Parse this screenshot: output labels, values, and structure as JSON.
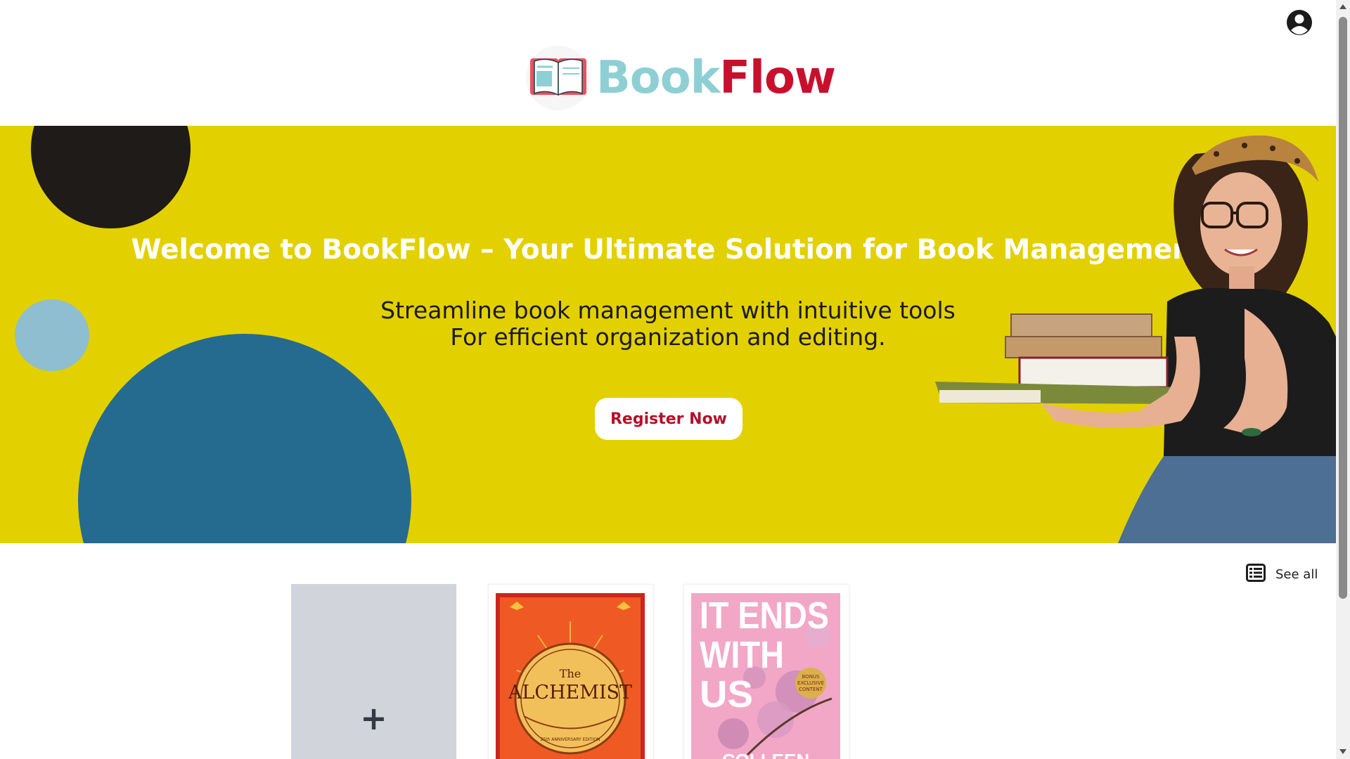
{
  "header": {
    "brand_part1": "Book",
    "brand_part2": "Flow",
    "account_icon": "user-circle-icon"
  },
  "hero": {
    "title": "Welcome to BookFlow – Your Ultimate Solution for Book Management",
    "subtitle_line1": "Streamline book management with intuitive tools",
    "subtitle_line2": "For efficient organization and editing.",
    "cta_label": "Register Now",
    "colors": {
      "background": "#e3d000",
      "cta_text": "#b4102a"
    }
  },
  "books": {
    "see_all_label": "See all",
    "see_all_icon": "list-icon",
    "add_label": "+",
    "items": [
      {
        "cover_lines": [
          "The",
          "ALCHEMIST"
        ],
        "cover_small": "25th ANNIVERSARY EDITION",
        "cover_color": "#e64b1e"
      },
      {
        "cover_lines": [
          "IT ENDS",
          "WITH",
          "US"
        ],
        "cover_badge": [
          "BONUS",
          "EXCLUSIVE",
          "CONTENT"
        ],
        "cover_author": "COLLEEN",
        "cover_color": "#f2a7c7"
      }
    ]
  }
}
